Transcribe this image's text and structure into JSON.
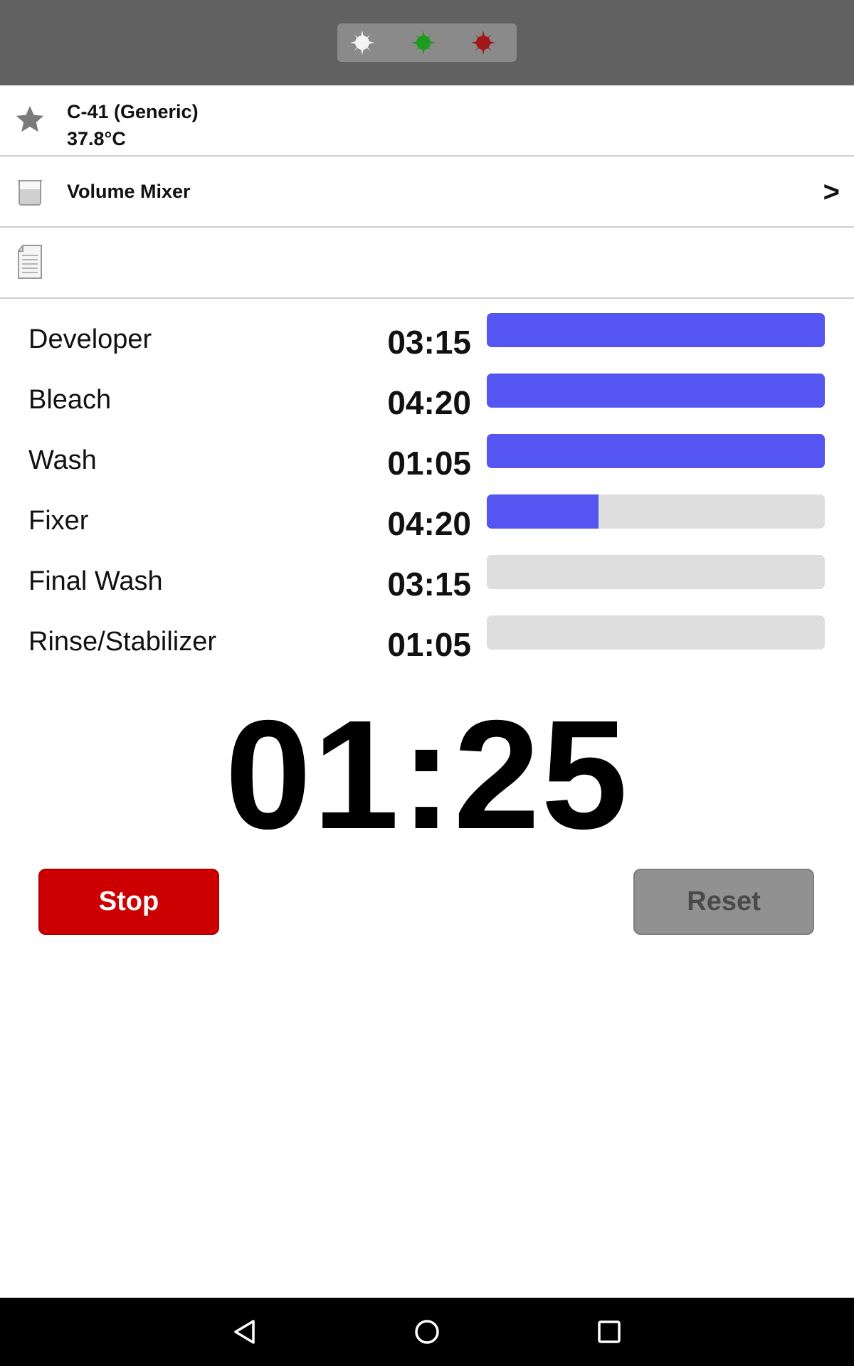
{
  "topbar": {
    "safelights": [
      {
        "icon": "white-safelight-icon",
        "color": "#ffffff"
      },
      {
        "icon": "green-safelight-icon",
        "color": "#1e9a1e"
      },
      {
        "icon": "red-safelight-icon",
        "color": "#a01818"
      }
    ]
  },
  "process": {
    "name": "C-41 (Generic)",
    "temperature": "37.8°C",
    "icon": "star-icon"
  },
  "mixer": {
    "label": "Volume Mixer",
    "arrow": ">",
    "icon": "beaker-icon"
  },
  "notes": {
    "icon": "document-icon"
  },
  "steps": [
    {
      "name": "Developer",
      "time": "03:15",
      "progress": 1.0
    },
    {
      "name": "Bleach",
      "time": "04:20",
      "progress": 1.0
    },
    {
      "name": "Wash",
      "time": "01:05",
      "progress": 1.0
    },
    {
      "name": "Fixer",
      "time": "04:20",
      "progress": 0.33
    },
    {
      "name": "Final Wash",
      "time": "03:15",
      "progress": 0.0
    },
    {
      "name": "Rinse/Stabilizer",
      "time": "01:05",
      "progress": 0.0
    }
  ],
  "countdown": "01:25",
  "buttons": {
    "stop_label": "Stop",
    "reset_label": "Reset"
  },
  "colors": {
    "progress_fill": "#5555f2",
    "progress_track": "#dedede",
    "stop_button": "#cc0000",
    "reset_button": "#919191"
  },
  "navbar": {
    "back_icon": "back-icon",
    "home_icon": "home-icon",
    "recents_icon": "recents-icon"
  }
}
